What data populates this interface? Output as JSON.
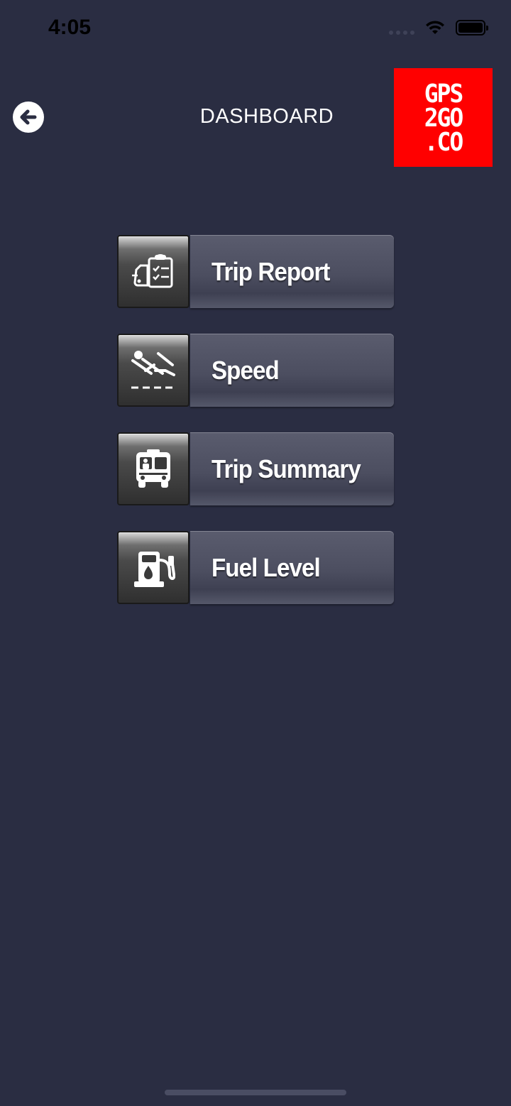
{
  "status_bar": {
    "time": "4:05"
  },
  "header": {
    "title": "DASHBOARD"
  },
  "logo": {
    "lines": [
      "GPS",
      "2GO",
      ".CO"
    ]
  },
  "menu": {
    "items": [
      {
        "label": "Trip Report",
        "icon": "trip-report-icon"
      },
      {
        "label": "Speed",
        "icon": "speed-icon"
      },
      {
        "label": "Trip Summary",
        "icon": "bus-icon"
      },
      {
        "label": "Fuel Level",
        "icon": "fuel-pump-icon"
      }
    ]
  },
  "colors": {
    "background": "#2a2d42",
    "logo": "#ff0000"
  }
}
